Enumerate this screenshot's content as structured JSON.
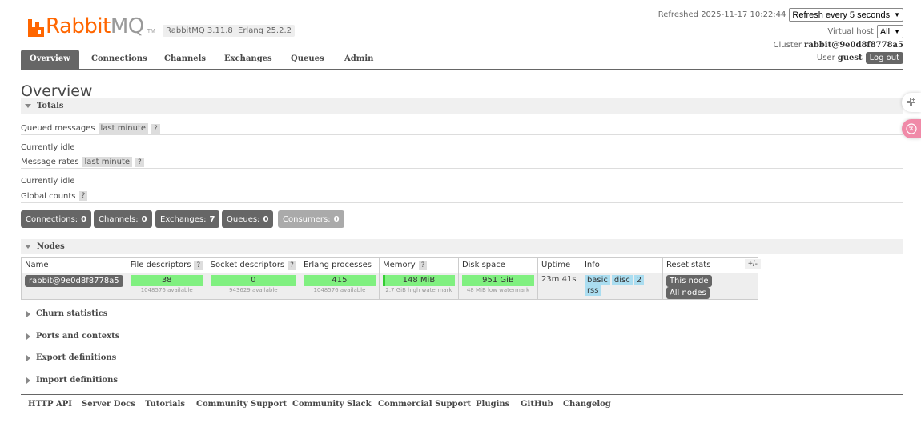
{
  "header": {
    "logo_text_a": "Rabbit",
    "logo_text_b": "MQ",
    "logo_tm": "TM",
    "version_badge": "RabbitMQ 3.11.8",
    "erlang_badge": "Erlang 25.2.2",
    "refreshed_label": "Refreshed 2025-11-17 10:22:44",
    "refresh_select": "Refresh every 5 seconds",
    "vhost_label": "Virtual host",
    "vhost_select": "All",
    "cluster_label": "Cluster",
    "cluster_name": "rabbit@9e0d8f8778a5",
    "user_label": "User",
    "user_name": "guest",
    "logout_label": "Log out"
  },
  "nav": {
    "tabs": [
      {
        "label": "Overview",
        "active": true
      },
      {
        "label": "Connections",
        "active": false
      },
      {
        "label": "Channels",
        "active": false
      },
      {
        "label": "Exchanges",
        "active": false
      },
      {
        "label": "Queues",
        "active": false
      },
      {
        "label": "Admin",
        "active": false
      }
    ]
  },
  "page": {
    "title": "Overview"
  },
  "totals": {
    "heading": "Totals",
    "queued_label": "Queued messages",
    "queued_chip": "last minute",
    "help": "?",
    "idle_1": "Currently idle",
    "rates_label": "Message rates",
    "rates_chip": "last minute",
    "idle_2": "Currently idle",
    "global_label": "Global counts"
  },
  "counts": {
    "connections_label": "Connections:",
    "connections_value": "0",
    "channels_label": "Channels:",
    "channels_value": "0",
    "exchanges_label": "Exchanges:",
    "exchanges_value": "7",
    "queues_label": "Queues:",
    "queues_value": "0",
    "consumers_label": "Consumers:",
    "consumers_value": "0"
  },
  "nodes": {
    "heading": "Nodes",
    "columns": [
      "Name",
      "File descriptors",
      "Socket descriptors",
      "Erlang processes",
      "Memory",
      "Disk space",
      "Uptime",
      "Info",
      "Reset stats"
    ],
    "help": "?",
    "plus_minus": "+/-",
    "row": {
      "name": "rabbit@9e0d8f8778a5",
      "fd_value": "38",
      "fd_sub": "1048576 available",
      "sockets_value": "0",
      "sockets_sub": "943629 available",
      "procs_value": "415",
      "procs_sub": "1048576 available",
      "memory_value": "148 MiB",
      "memory_sub": "2.7 GiB high watermark",
      "disk_value": "951 GiB",
      "disk_sub": "48 MiB low watermark",
      "uptime": "23m 41s",
      "info_tags": [
        "basic",
        "disc",
        "2",
        "rss"
      ],
      "reset_this": "This node",
      "reset_all": "All nodes"
    }
  },
  "collapsed_sections": [
    "Churn statistics",
    "Ports and contexts",
    "Export definitions",
    "Import definitions"
  ],
  "footer": {
    "links": [
      "HTTP API",
      "Server Docs",
      "Tutorials",
      "Community Support",
      "Community Slack",
      "Commercial Support",
      "Plugins",
      "GitHub",
      "Changelog"
    ]
  },
  "side_widgets": {
    "icon_top": "apps-add-icon",
    "icon_bottom": "translate-icon"
  }
}
